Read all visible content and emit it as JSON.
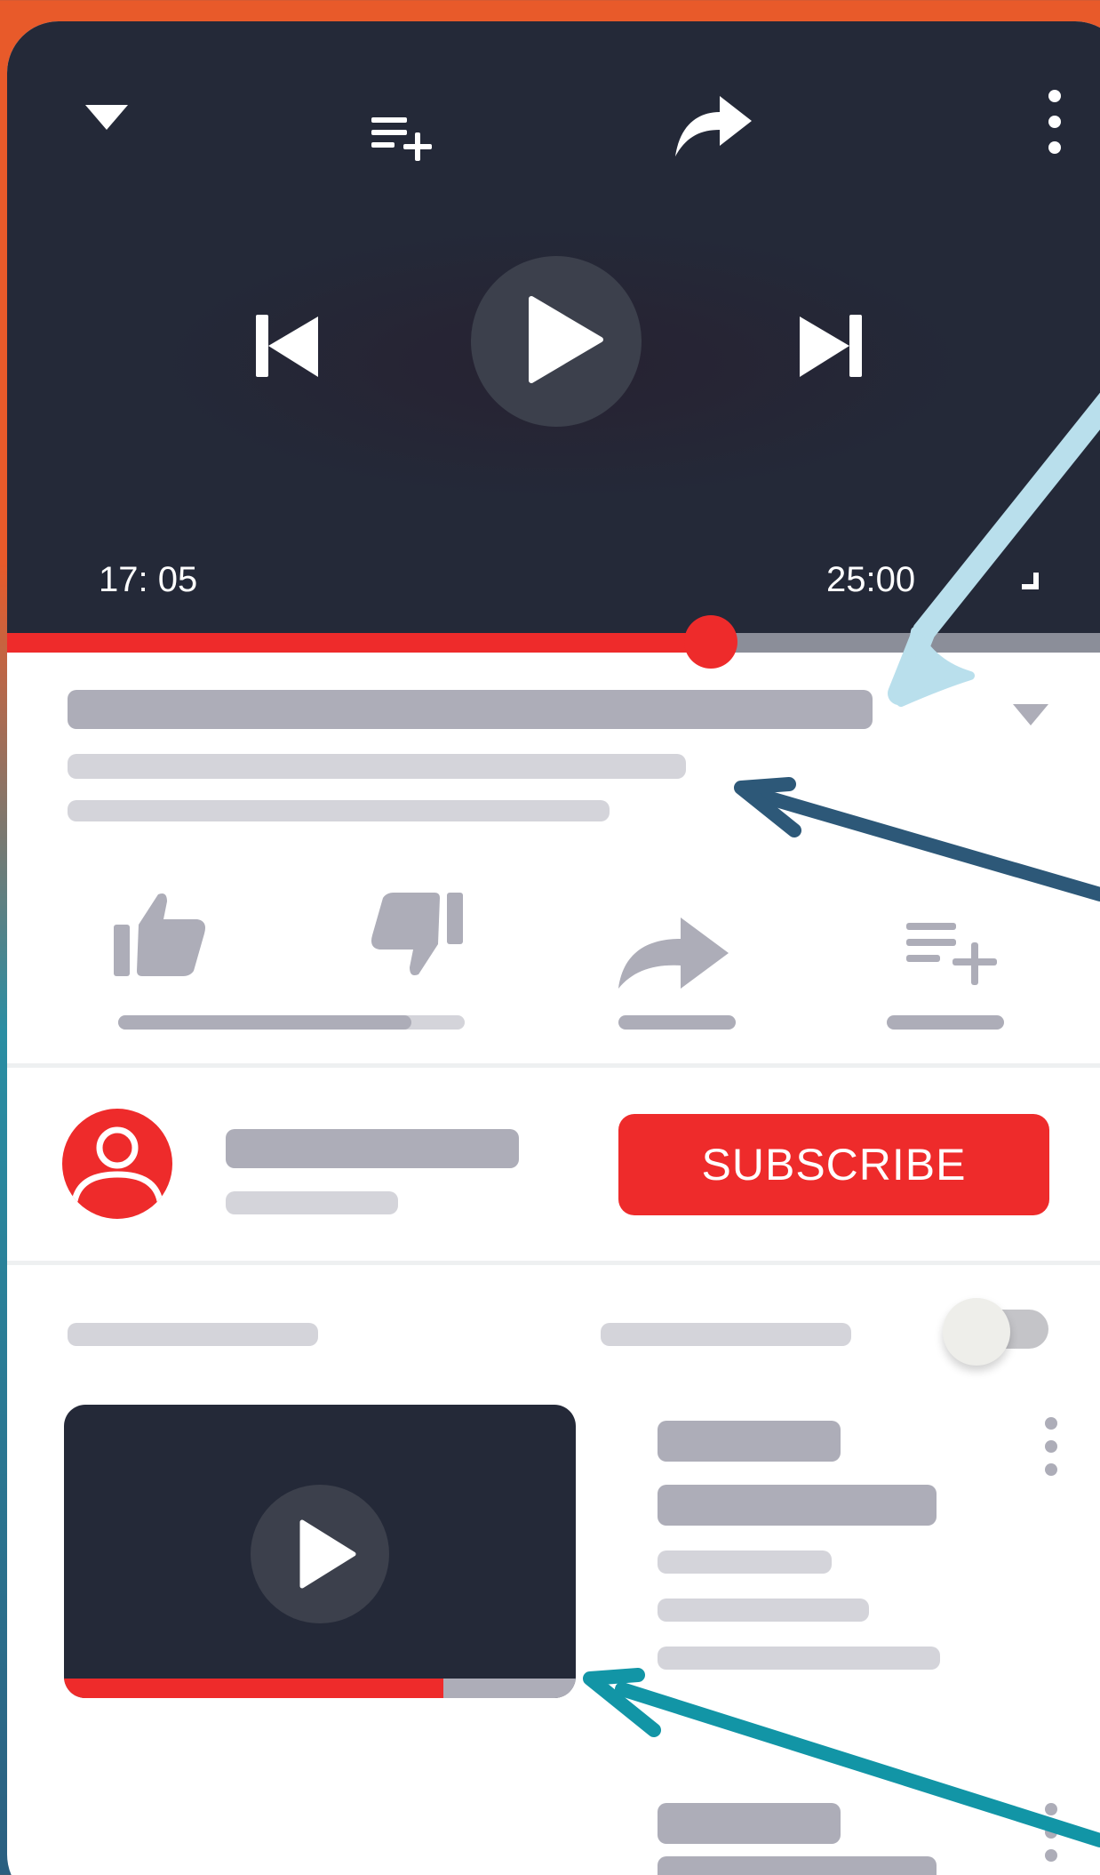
{
  "player": {
    "current_time": "17: 05",
    "duration": "25:00",
    "progress_fraction": 0.683
  },
  "channel": {
    "subscribe_label": "SUBSCRIBE"
  },
  "up_next": {
    "autoplay_on": false,
    "thumbnail_progress_fraction": 0.741
  },
  "colors": {
    "accent_red": "#ee2b2b",
    "player_bg": "#242938",
    "placeholder_dark": "#adadb8",
    "placeholder_light": "#d4d4da",
    "arrow_light_blue": "#b9dfec",
    "arrow_navy": "#2d5878",
    "arrow_teal": "#1295a6"
  },
  "icons": {
    "collapse": "chevron-down-icon",
    "add_to_queue": "playlist-add-icon",
    "share": "share-icon",
    "more": "more-vertical-icon",
    "previous": "skip-previous-icon",
    "play": "play-icon",
    "next": "skip-next-icon",
    "fullscreen": "fullscreen-icon",
    "like": "thumbs-up-icon",
    "dislike": "thumbs-down-icon",
    "avatar": "user-icon"
  }
}
